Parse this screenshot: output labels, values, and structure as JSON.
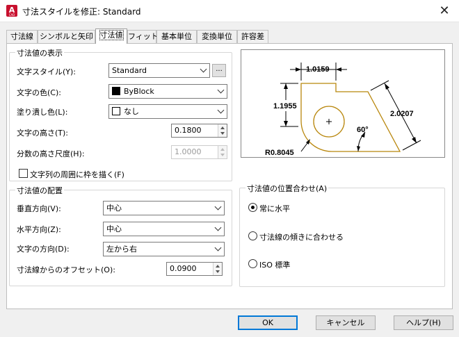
{
  "window": {
    "title": "寸法スタイルを修正: Standard",
    "app_icon_letter": "A",
    "app_icon_sub": "CAD",
    "close_glyph": "✕"
  },
  "tabs": [
    {
      "label": "寸法線"
    },
    {
      "label": "シンボルと矢印"
    },
    {
      "label": "寸法値"
    },
    {
      "label": "フィット"
    },
    {
      "label": "基本単位"
    },
    {
      "label": "変換単位"
    },
    {
      "label": "許容差"
    }
  ],
  "text_appearance": {
    "title": "寸法値の表示",
    "style_label": "文字スタイル(Y):",
    "style_value": "Standard",
    "browse_label": "...",
    "color_label": "文字の色(C):",
    "color_value": "ByBlock",
    "color_swatch": "#000000",
    "fill_label": "塗り潰し色(L):",
    "fill_value": "なし",
    "height_label": "文字の高さ(T):",
    "height_value": "0.1800",
    "fraction_label": "分数の高さ尺度(H):",
    "fraction_value": "1.0000",
    "frame_label": "文字列の周囲に枠を描く(F)"
  },
  "placement": {
    "title": "寸法値の配置",
    "vertical_label": "垂直方向(V):",
    "vertical_value": "中心",
    "horizontal_label": "水平方向(Z):",
    "horizontal_value": "中心",
    "direction_label": "文字の方向(D):",
    "direction_value": "左から右",
    "offset_label": "寸法線からのオフセット(O):",
    "offset_value": "0.0900"
  },
  "alignment": {
    "title": "寸法値の位置合わせ(A)",
    "options": [
      {
        "label": "常に水平",
        "checked": true
      },
      {
        "label": "寸法線の傾きに合わせる",
        "checked": false
      },
      {
        "label": "ISO 標準",
        "checked": false
      }
    ]
  },
  "preview": {
    "dim_top": "1.0159",
    "dim_left": "1.1955",
    "dim_right": "2.0207",
    "dim_angle": "60°",
    "dim_radius": "R0.8045",
    "outline_color": "#b8860b"
  },
  "footer": {
    "ok_label": "OK",
    "cancel_label": "キャンセル",
    "help_label": "ヘルプ(H)"
  }
}
